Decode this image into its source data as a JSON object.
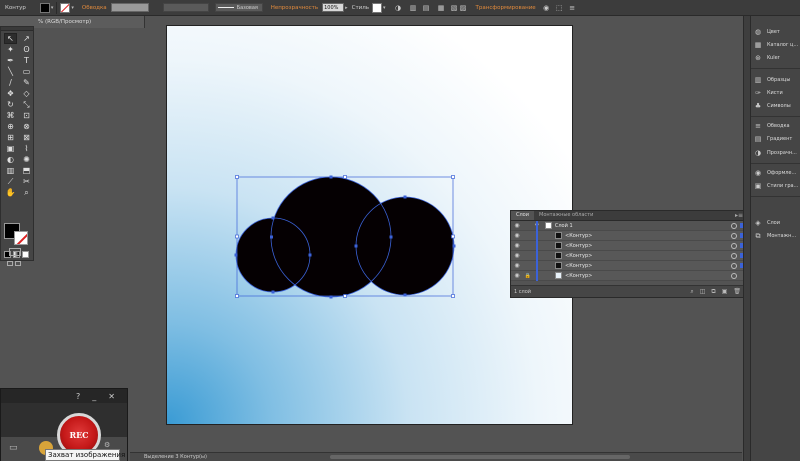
{
  "control_bar": {
    "selection_label": "Контур",
    "stroke_label": "Обводка",
    "stroke_profile": "Базовая",
    "opacity_label": "Непрозрачность",
    "opacity_value": "100%",
    "style_label": "Стиль",
    "transform_label": "Трансформирование"
  },
  "document_tab": {
    "title": "% (RGB/Просмотр)"
  },
  "layers_panel": {
    "tabs": [
      "Слои",
      "Монтажные области"
    ],
    "layer_name": "Слой 1",
    "sublayers": [
      "<Контур>",
      "<Контур>",
      "<Контур>",
      "<Контур>",
      "<Контур>"
    ],
    "count_label": "1 слой"
  },
  "dock": {
    "items": [
      {
        "label": "Цвет",
        "icon": "color-icon"
      },
      {
        "label": "Каталог ц...",
        "icon": "color-guide-icon"
      },
      {
        "label": "Kuler",
        "icon": "kuler-icon"
      },
      {
        "label": "Образцы",
        "icon": "swatches-icon"
      },
      {
        "label": "Кисти",
        "icon": "brushes-icon"
      },
      {
        "label": "Символы",
        "icon": "symbols-icon"
      },
      {
        "label": "Обводка",
        "icon": "stroke-icon"
      },
      {
        "label": "Градиент",
        "icon": "gradient-icon"
      },
      {
        "label": "Прозрачн...",
        "icon": "transparency-icon"
      },
      {
        "label": "Оформле...",
        "icon": "appearance-icon"
      },
      {
        "label": "Стили гра...",
        "icon": "graphic-styles-icon"
      },
      {
        "label": "Слои",
        "icon": "layers-icon"
      },
      {
        "label": "Монтажн...",
        "icon": "artboards-icon"
      }
    ]
  },
  "capture_app": {
    "help_label": "?",
    "minimize_label": "_",
    "close_label": "✕",
    "rec_label": "REC",
    "tooltip": "Захват изображения"
  },
  "status_bar": {
    "text": "Выделение 3 Контур(ы)"
  },
  "colors": {
    "artboard_gradient": "#3a9bd4",
    "selection_blue": "#3b62d8",
    "shape_fill": "#000000",
    "orange_label": "#e08a3c",
    "rec_red": "#c41818"
  }
}
